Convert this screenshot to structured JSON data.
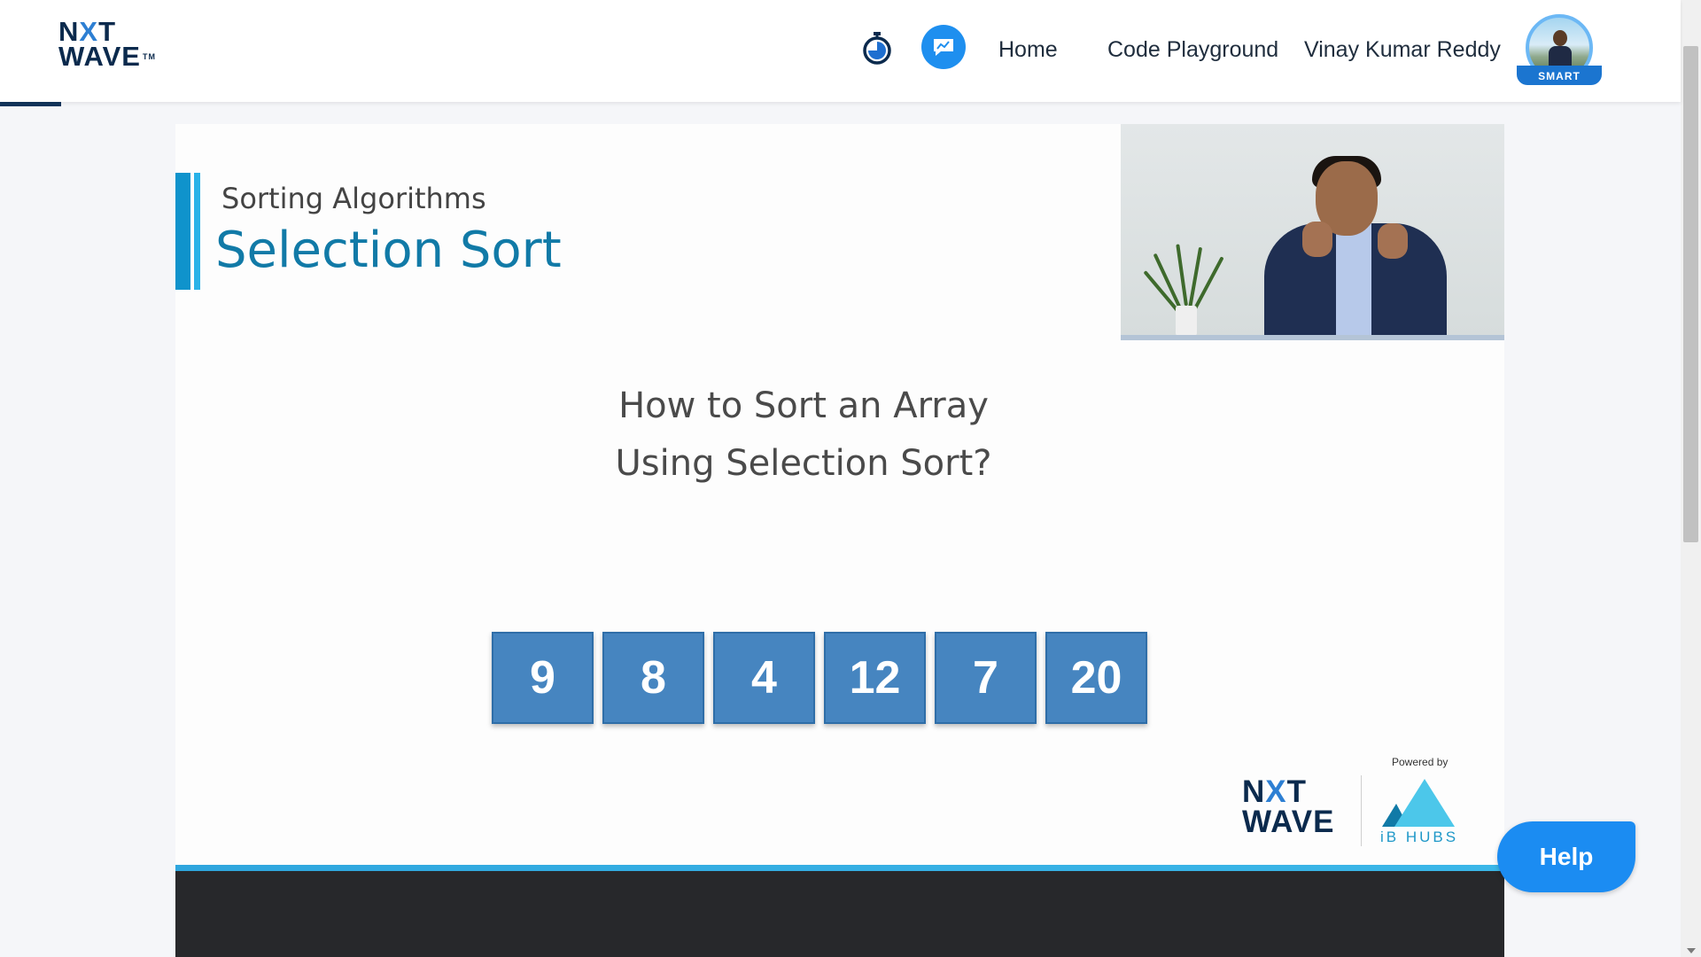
{
  "header": {
    "logo_line1_a": "N",
    "logo_line1_x": "X",
    "logo_line1_b": "T",
    "logo_line2": "WAVE",
    "logo_tm": "TM",
    "nav": {
      "home": "Home",
      "code_playground": "Code Playground"
    },
    "user_name": "Vinay Kumar Reddy",
    "badge": "SMART",
    "icons": {
      "timer": "stopwatch-icon",
      "chat": "chat-icon"
    }
  },
  "slide": {
    "subtitle": "Sorting Algorithms",
    "title": "Selection Sort",
    "question_line1": "How to Sort an Array",
    "question_line2": "Using Selection Sort?",
    "array": [
      "9",
      "8",
      "4",
      "12",
      "7",
      "20"
    ],
    "powered_by": "Powered by",
    "brand_line1_a": "N",
    "brand_line1_x": "X",
    "brand_line1_b": "T",
    "brand_line2": "WAVE",
    "ibhubs": "iB HUBS"
  },
  "help": {
    "label": "Help"
  },
  "colors": {
    "accent": "#1b8cf2",
    "slide_title": "#117aa7",
    "array_cell": "#4685c0"
  }
}
